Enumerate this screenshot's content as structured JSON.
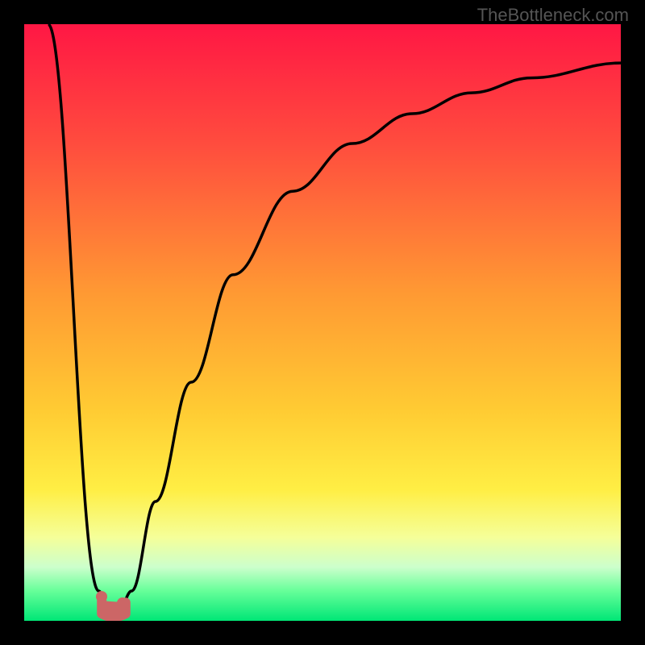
{
  "watermark": "TheBottleneck.com",
  "chart_data": {
    "type": "line",
    "title": "",
    "xlabel": "",
    "ylabel": "",
    "xlim": [
      0,
      100
    ],
    "ylim": [
      0,
      100
    ],
    "description": "Bottleneck curve showing optimal point near x≈15 with steep V-shape and asymptotic rise",
    "curve_points": [
      {
        "x": 4,
        "y": 100
      },
      {
        "x": 12.5,
        "y": 5
      },
      {
        "x": 14,
        "y": 2
      },
      {
        "x": 16,
        "y": 2
      },
      {
        "x": 18,
        "y": 5
      },
      {
        "x": 22,
        "y": 20
      },
      {
        "x": 28,
        "y": 40
      },
      {
        "x": 35,
        "y": 58
      },
      {
        "x": 45,
        "y": 72
      },
      {
        "x": 55,
        "y": 80
      },
      {
        "x": 65,
        "y": 85
      },
      {
        "x": 75,
        "y": 88.5
      },
      {
        "x": 85,
        "y": 91
      },
      {
        "x": 100,
        "y": 93.5
      }
    ],
    "minimum_region": {
      "x_start": 13,
      "x_end": 17,
      "y": 2
    },
    "markers": [
      {
        "x": 13,
        "y": 4
      },
      {
        "x": 16.5,
        "y": 3
      }
    ],
    "gradient_stops": [
      {
        "pos": 0,
        "color": "#ff1744"
      },
      {
        "pos": 20,
        "color": "#ff4c3e"
      },
      {
        "pos": 45,
        "color": "#ff9933"
      },
      {
        "pos": 65,
        "color": "#ffcc33"
      },
      {
        "pos": 78,
        "color": "#ffee44"
      },
      {
        "pos": 86,
        "color": "#f5ff99"
      },
      {
        "pos": 91,
        "color": "#ccffcc"
      },
      {
        "pos": 95,
        "color": "#66ff99"
      },
      {
        "pos": 100,
        "color": "#00e676"
      }
    ]
  }
}
